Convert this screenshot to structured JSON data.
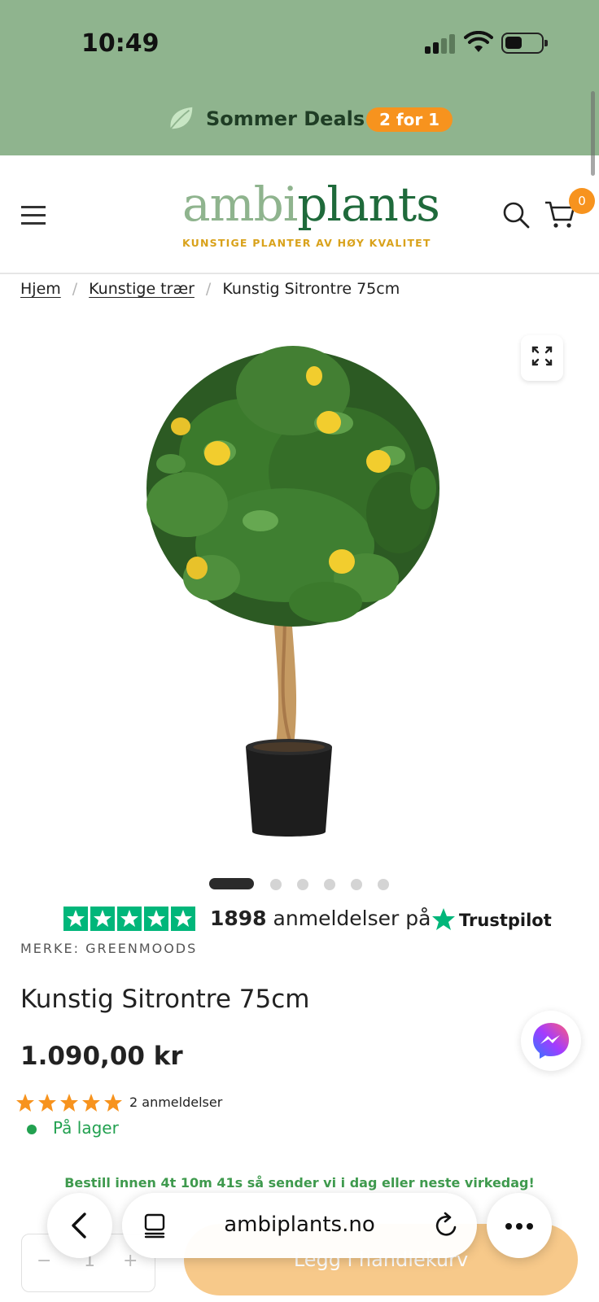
{
  "status_bar": {
    "time": "10:49"
  },
  "promo": {
    "text": "Sommer Deals",
    "badge": "2 for 1"
  },
  "header": {
    "logo_part1": "ambi",
    "logo_part2": "plants",
    "tagline": "KUNSTIGE PLANTER AV HØY KVALITET",
    "cart_count": "0"
  },
  "breadcrumb": {
    "items": [
      "Hjem",
      "Kunstige trær",
      "Kunstig Sitrontre 75cm"
    ],
    "separator": "/"
  },
  "gallery": {
    "image_count": 6,
    "active_index": 0
  },
  "trustpilot": {
    "count": "1898",
    "text": "anmeldelser på",
    "brand": "Trustpilot"
  },
  "product": {
    "brand": "MERKE: GREENMOODS",
    "title": "Kunstig Sitrontre 75cm",
    "price": "1.090,00 kr",
    "rating_stars": 5,
    "reviews": "2 anmeldelser",
    "stock": "På lager",
    "shipping_notice": "Bestill innen 4t 10m 41s så sender vi i dag eller neste virkedag!",
    "qty_minus": "−",
    "quantity": "1",
    "qty_plus": "+",
    "add_to_cart": "Legg i handlekurv"
  },
  "browser": {
    "url": "ambiplants.no"
  },
  "colors": {
    "brand_light_green": "#8fb48e",
    "brand_dark_green": "#1f6a3b",
    "accent_orange": "#f7931e",
    "tagline_gold": "#d9a21b",
    "trustpilot_green": "#00b67a",
    "stock_green": "#22a150"
  }
}
